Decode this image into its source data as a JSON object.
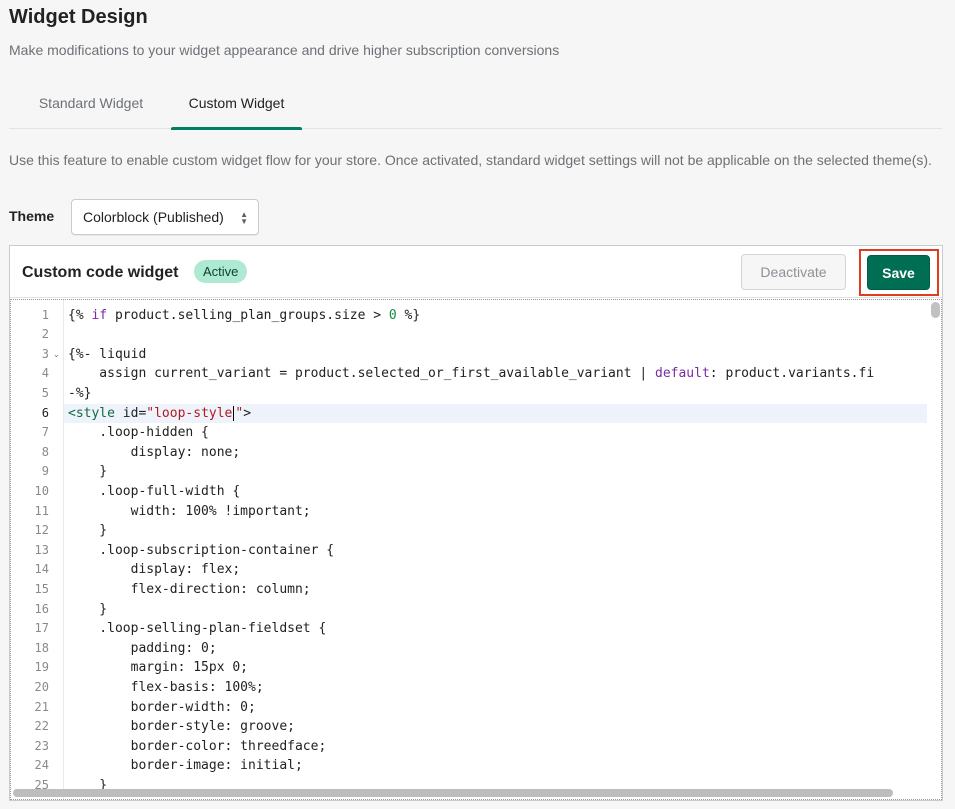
{
  "page": {
    "title": "Widget Design",
    "subtitle": "Make modifications to your widget appearance and drive higher subscription conversions"
  },
  "tabs": [
    {
      "label": "Standard Widget",
      "active": false
    },
    {
      "label": "Custom Widget",
      "active": true
    }
  ],
  "info_text": "Use this feature to enable custom widget flow for your store. Once activated, standard widget settings will not be applicable on the selected theme(s).",
  "theme": {
    "label": "Theme",
    "selected": "Colorblock (Published)"
  },
  "card": {
    "title": "Custom code widget",
    "badge": "Active",
    "deactivate_label": "Deactivate",
    "save_label": "Save"
  },
  "editor": {
    "active_line": 6,
    "lines": [
      {
        "n": "1"
      },
      {
        "n": "2"
      },
      {
        "n": "3"
      },
      {
        "n": "4"
      },
      {
        "n": "5"
      },
      {
        "n": "6"
      },
      {
        "n": "7"
      },
      {
        "n": "8"
      },
      {
        "n": "9"
      },
      {
        "n": "10"
      },
      {
        "n": "11"
      },
      {
        "n": "12"
      },
      {
        "n": "13"
      },
      {
        "n": "14"
      },
      {
        "n": "15"
      },
      {
        "n": "16"
      },
      {
        "n": "17"
      },
      {
        "n": "18"
      },
      {
        "n": "19"
      },
      {
        "n": "20"
      },
      {
        "n": "21"
      },
      {
        "n": "22"
      },
      {
        "n": "23"
      },
      {
        "n": "24"
      },
      {
        "n": "25"
      }
    ],
    "code": {
      "l1_a": "{% ",
      "l1_if": "if",
      "l1_b": " product.selling_plan_groups.size > ",
      "l1_num": "0",
      "l1_c": " %}",
      "l3": "{%- liquid",
      "l4_a": "    assign current_variant = product.selected_or_first_available_variant | ",
      "l4_kw": "default",
      "l4_b": ": product.variants.fi",
      "l5": "-%}",
      "l6_a": "<style",
      "l6_b": " id=",
      "l6_str": "\"loop-style",
      "l6_str2": "\"",
      "l6_c": ">",
      "l7": "    .loop-hidden {",
      "l8": "        display: none;",
      "l9": "    }",
      "l10": "    .loop-full-width {",
      "l11": "        width: 100% !important;",
      "l12": "    }",
      "l13": "    .loop-subscription-container {",
      "l14": "        display: flex;",
      "l15": "        flex-direction: column;",
      "l16": "    }",
      "l17": "    .loop-selling-plan-fieldset {",
      "l18": "        padding: 0;",
      "l19": "        margin: 15px 0;",
      "l20": "        flex-basis: 100%;",
      "l21": "        border-width: 0;",
      "l22": "        border-style: groove;",
      "l23": "        border-color: threedface;",
      "l24": "        border-image: initial;",
      "l25": "    }"
    }
  }
}
